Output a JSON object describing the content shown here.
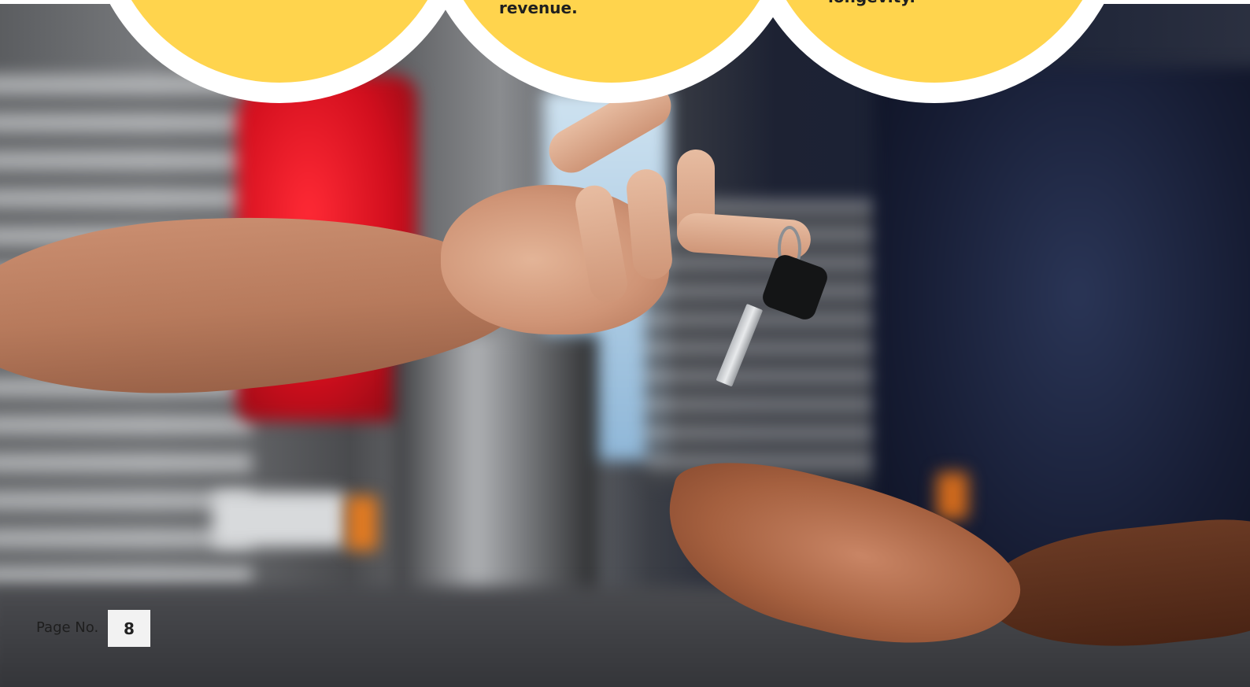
{
  "circles": {
    "middle_text": "revenue.",
    "right_text": "longevity."
  },
  "footer": {
    "page_label": "Page No.",
    "page_number": "8"
  },
  "colors": {
    "circle_fill": "#ffd44d",
    "circle_ring": "#ffffff"
  }
}
